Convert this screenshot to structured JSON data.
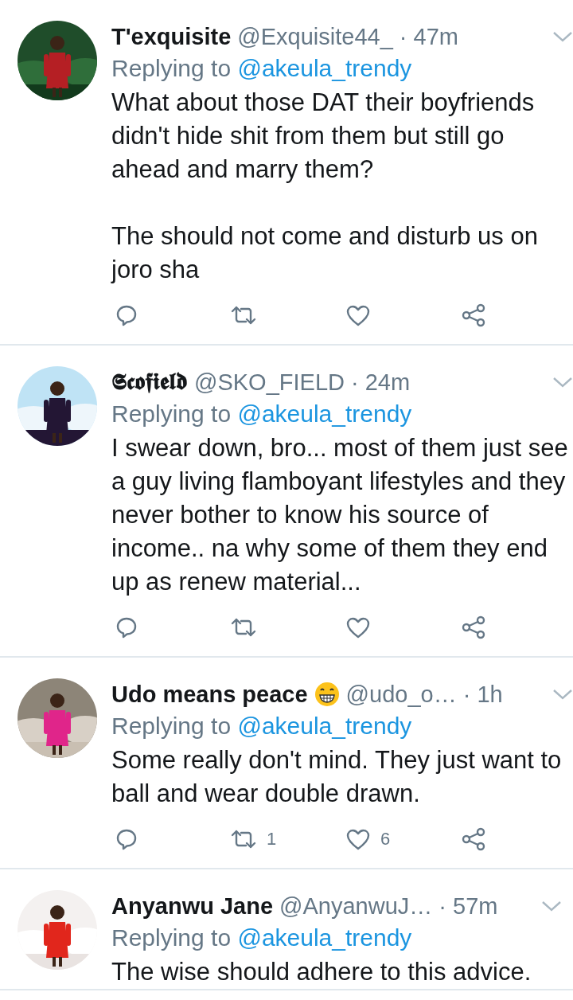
{
  "tweets": [
    {
      "avatar": {
        "kind": "picture"
      },
      "name": "T'exquisite",
      "emoji": false,
      "handle": "@Exquisite44_",
      "time": "· 47m",
      "replying_label": "Replying to",
      "replying_to": "@akeula_trendy",
      "body": [
        "What about those DAT their boyfriends didn't hide shit from them but still go ahead and marry them?",
        "The should not come and disturb us on joro sha"
      ],
      "actions": [
        {
          "kind": "reply"
        },
        {
          "kind": "retweet"
        },
        {
          "kind": "like"
        },
        {
          "kind": "share"
        }
      ]
    },
    {
      "avatar": {
        "kind": "picture"
      },
      "name": "𝕾𝖈𝖔𝖋𝖎𝖊𝖑𝖉",
      "emoji": false,
      "handle": "@SKO_FIELD",
      "time": "· 24m",
      "replying_label": "Replying to",
      "replying_to": "@akeula_trendy",
      "body": [
        "I swear down, bro... most of them just see a guy living flamboyant lifestyles and they never bother to know his source of income.. na why some of them they end up as renew material..."
      ],
      "actions": [
        {
          "kind": "reply"
        },
        {
          "kind": "retweet"
        },
        {
          "kind": "like"
        },
        {
          "kind": "share"
        }
      ]
    },
    {
      "avatar": {
        "kind": "picture"
      },
      "name": "Udo means peace",
      "emoji": true,
      "handle": "@udo_o…",
      "time": "· 1h",
      "replying_label": "Replying to",
      "replying_to": "@akeula_trendy",
      "body": [
        "Some really don't mind. They just want to ball and wear double drawn."
      ],
      "actions": [
        {
          "kind": "reply"
        },
        {
          "kind": "retweet",
          "count": "1"
        },
        {
          "kind": "like",
          "count": "6"
        },
        {
          "kind": "share"
        }
      ]
    },
    {
      "avatar": {
        "kind": "picture"
      },
      "name": "Anyanwu Jane",
      "emoji": false,
      "handle": "@AnyanwuJ…",
      "time": "· 57m",
      "replying_label": "Replying to",
      "replying_to": "@akeula_trendy",
      "body": [
        "The wise should adhere to this advice."
      ]
    }
  ]
}
